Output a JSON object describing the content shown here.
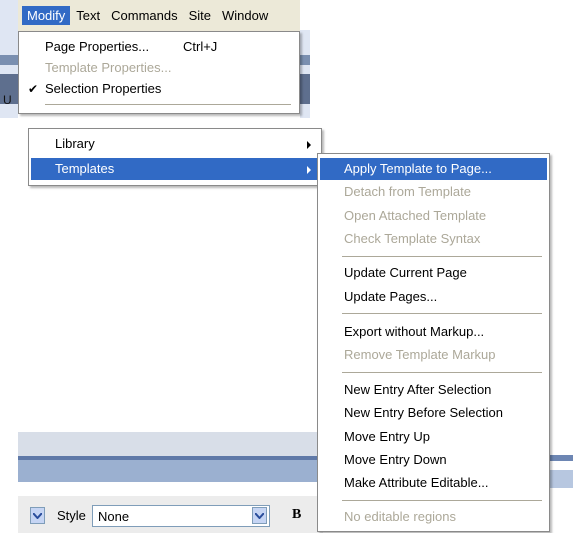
{
  "menubar": {
    "items": [
      "Modify",
      "Text",
      "Commands",
      "Site",
      "Window"
    ],
    "active_index": 0
  },
  "modify_menu": {
    "items": [
      {
        "label": "Page Properties...",
        "shortcut": "Ctrl+J",
        "disabled": false
      },
      {
        "label": "Template Properties...",
        "disabled": true
      },
      {
        "label": "Selection Properties",
        "checked": true,
        "disabled": false
      }
    ],
    "lower_items": [
      {
        "label": "Library",
        "submenu": true
      },
      {
        "label": "Templates",
        "submenu": true,
        "highlighted": true
      }
    ]
  },
  "templates_menu": {
    "items": [
      {
        "label": "Apply Template to Page...",
        "highlighted": true
      },
      {
        "label": "Detach from Template",
        "disabled": true
      },
      {
        "label": "Open Attached Template",
        "disabled": true
      },
      {
        "label": "Check Template Syntax",
        "disabled": true
      },
      {
        "label": "Update Current Page"
      },
      {
        "label": "Update Pages..."
      },
      {
        "label": "Export without Markup..."
      },
      {
        "label": "Remove Template Markup",
        "disabled": true
      },
      {
        "label": "New Entry After Selection"
      },
      {
        "label": "New Entry Before Selection"
      },
      {
        "label": "Move Entry Up"
      },
      {
        "label": "Move Entry Down"
      },
      {
        "label": "Make Attribute Editable..."
      },
      {
        "label": "No editable regions",
        "disabled": true
      }
    ]
  },
  "properties": {
    "style_label": "Style",
    "style_value": "None",
    "bold_label": "B"
  },
  "background": {
    "left_glyph": "U"
  },
  "icons": {
    "check": "checkmark-icon",
    "submenu": "submenu-arrow-icon",
    "dropdown": "chevron-down-icon"
  },
  "colors": {
    "highlight": "#316ac5",
    "disabled_text": "#aca899",
    "menubar_bg": "#ece9d8"
  }
}
